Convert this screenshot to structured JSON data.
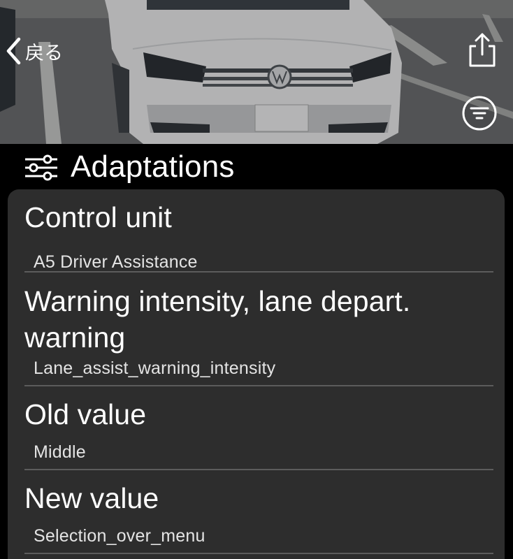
{
  "nav": {
    "back_label": "戻る",
    "back_icon": "chevron-left-icon",
    "share_icon": "share-icon",
    "filter_icon": "filter-icon"
  },
  "section": {
    "icon": "sliders-icon",
    "title": "Adaptations"
  },
  "rows": [
    {
      "title": "Control unit",
      "value": "A5 Driver Assistance"
    },
    {
      "title": "Warning intensity, lane depart. warning",
      "value": "Lane_assist_warning_intensity"
    },
    {
      "title": "Old value",
      "value": "Middle"
    },
    {
      "title": "New value",
      "value": "Selection_over_menu"
    }
  ],
  "colors": {
    "background": "#000000",
    "card": "#2d2d2d",
    "divider": "#5c5c5c",
    "text": "#ffffff"
  }
}
